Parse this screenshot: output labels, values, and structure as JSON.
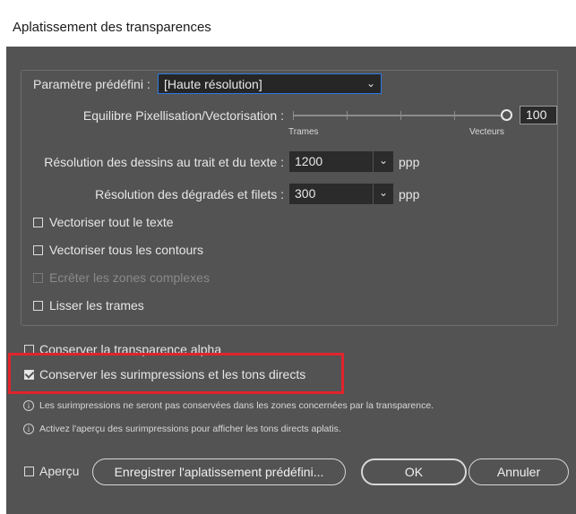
{
  "window": {
    "title": "Aplatissement des transparences"
  },
  "preset": {
    "label": "Paramètre prédéfini :",
    "value": "[Haute résolution]"
  },
  "balance": {
    "label": "Equilibre Pixellisation/Vectorisation :",
    "left_label": "Trames",
    "right_label": "Vecteurs",
    "value": "100",
    "level": 100
  },
  "line_art_res": {
    "label": "Résolution des dessins au trait et du texte :",
    "value": "1200",
    "unit": "ppp"
  },
  "gradient_res": {
    "label": "Résolution des dégradés et filets :",
    "value": "300",
    "unit": "ppp"
  },
  "options": [
    {
      "label": "Vectoriser tout le texte",
      "checked": false,
      "disabled": false
    },
    {
      "label": "Vectoriser tous les contours",
      "checked": false,
      "disabled": false
    },
    {
      "label": "Ecrêter les zones complexes",
      "checked": false,
      "disabled": true
    },
    {
      "label": "Lisser les trames",
      "checked": false,
      "disabled": false
    }
  ],
  "alpha": {
    "label": "Conserver la transparence alpha",
    "checked": false
  },
  "overprint": {
    "label": "Conserver les surimpressions et les tons directs",
    "checked": true
  },
  "info": [
    "Les surimpressions ne seront pas conservées dans les zones concernées par la transparence.",
    "Activez l'aperçu des surimpressions pour afficher les tons directs aplatis."
  ],
  "footer": {
    "preview_label": "Aperçu",
    "save_label": "Enregistrer l'aplatissement prédéfini...",
    "ok_label": "OK",
    "cancel_label": "Annuler"
  },
  "colors": {
    "panel": "#535353",
    "highlight": "#e0242c",
    "focus": "#2d7be5"
  }
}
